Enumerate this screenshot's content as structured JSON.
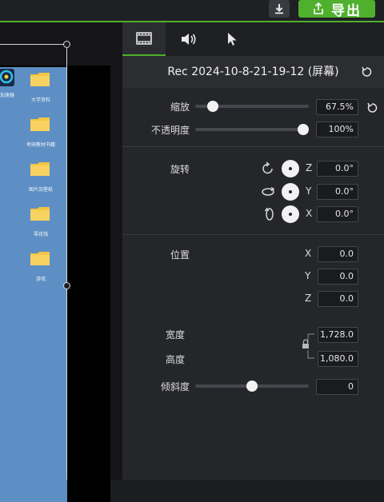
{
  "toolbar": {
    "export_label": "导出",
    "download_icon": "download-arrow-icon",
    "export_icon": "share-export-icon"
  },
  "desktop": {
    "icons": [
      {
        "name": "folder",
        "label": "大学资料"
      },
      {
        "name": "folder",
        "label": "考研教材书籍"
      },
      {
        "name": "folder",
        "label": "图片及壁纸"
      },
      {
        "name": "folder",
        "label": "零花钱"
      },
      {
        "name": "folder",
        "label": "游戏"
      }
    ],
    "app_label": "加速器"
  },
  "tabs": [
    {
      "icon": "film-icon"
    },
    {
      "icon": "audio-icon"
    },
    {
      "icon": "cursor-icon"
    }
  ],
  "properties": {
    "title": "Rec 2024-10-8-21-19-12 (屏幕)",
    "scale": {
      "label": "缩放",
      "value": "67.5%",
      "fraction": 0.0
    },
    "opacity": {
      "label": "不透明度",
      "value": "100%",
      "fraction": 1.0
    },
    "rotation": {
      "label": "旋转",
      "z": {
        "axis": "Z",
        "value": "0.0°"
      },
      "y": {
        "axis": "Y",
        "value": "0.0°"
      },
      "x": {
        "axis": "X",
        "value": "0.0°"
      }
    },
    "position": {
      "label": "位置",
      "x": {
        "axis": "X",
        "value": "0.0"
      },
      "y": {
        "axis": "Y",
        "value": "0.0"
      },
      "z": {
        "axis": "Z",
        "value": "0.0"
      }
    },
    "width": {
      "label": "宽度",
      "value": "1,728.0"
    },
    "height": {
      "label": "高度",
      "value": "1,080.0"
    },
    "skew": {
      "label": "倾斜度",
      "value": "0",
      "fraction": 0.5
    }
  },
  "colors": {
    "accent": "#4fb02e",
    "panel": "#25262a",
    "desktop": "#5d8fc4"
  }
}
